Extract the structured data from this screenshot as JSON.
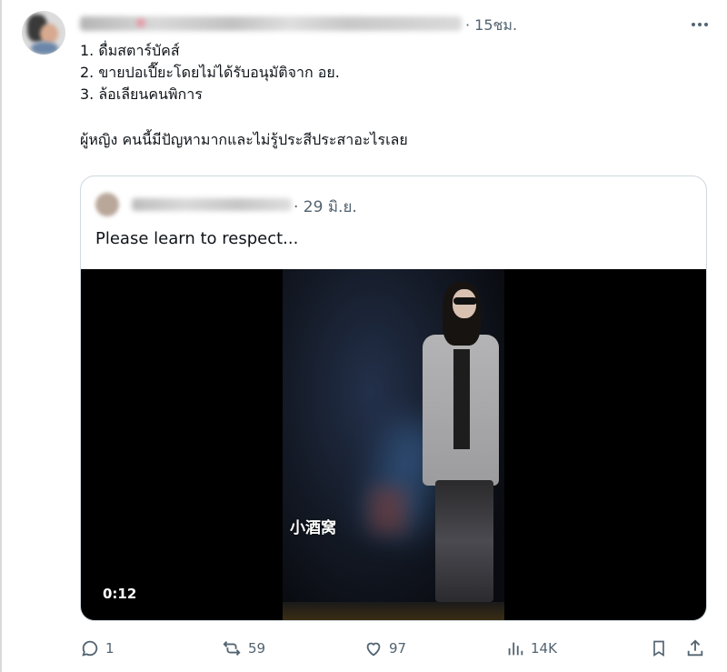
{
  "tweet": {
    "time": "· 15ชม.",
    "lines": [
      "1. ดื่มสตาร์บัคส์",
      "2. ขายปอเปี๊ยะโดยไม่ได้รับอนุมัติจาก อย.",
      "3. ล้อเลียนคนพิการ",
      "ผู้หญิง คนนี้มีปัญหามากและไม่รู้ประสีประสาอะไรเลย"
    ]
  },
  "quote": {
    "time": "· 29 มิ.ย.",
    "text": "Please learn to respect...",
    "video": {
      "overlay_text": "小酒窝",
      "duration": "0:12"
    }
  },
  "actions": {
    "replies": "1",
    "retweets": "59",
    "likes": "97",
    "views": "14K"
  },
  "colors": {
    "secondary_text": "#536471",
    "border": "#cfd9de",
    "text": "#0f1419"
  }
}
